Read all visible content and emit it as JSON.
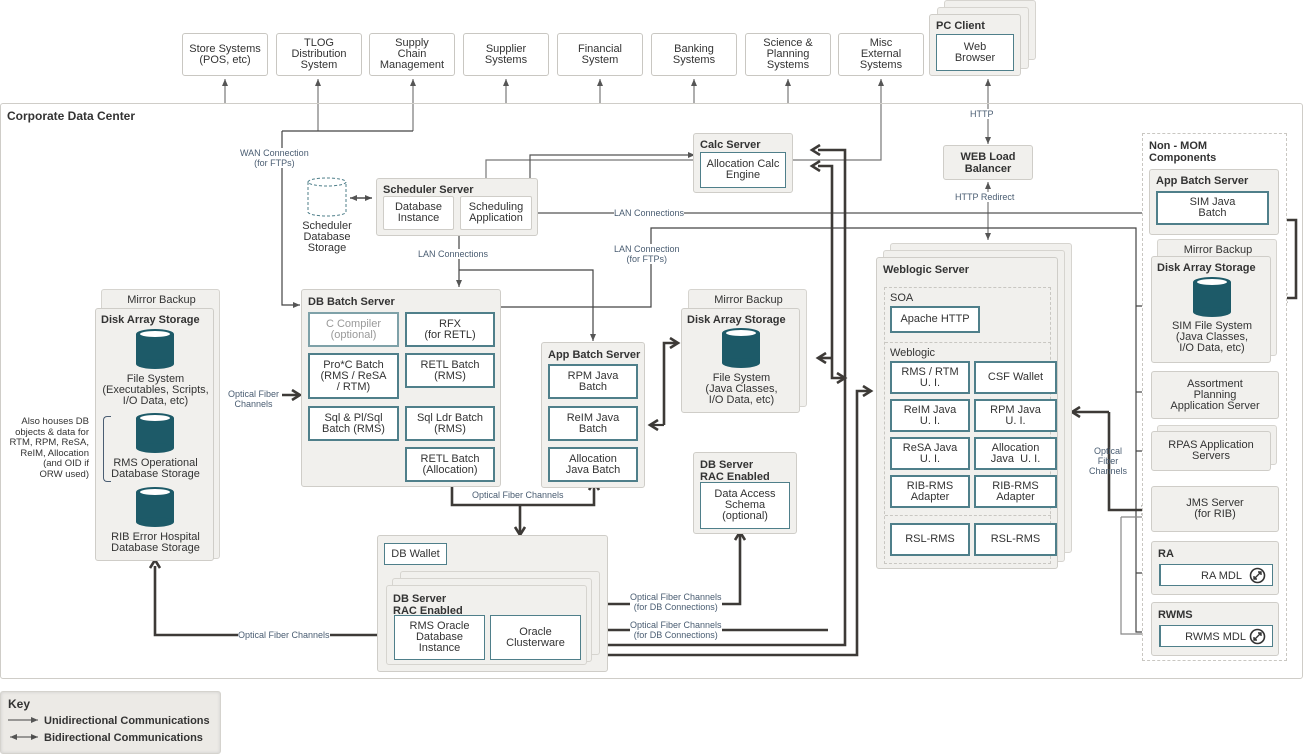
{
  "external_systems": [
    {
      "label": "Store Systems\n(POS, etc)"
    },
    {
      "label": "TLOG\nDistribution\nSystem"
    },
    {
      "label": "Supply\nChain\nManagement"
    },
    {
      "label": "Supplier\nSystems"
    },
    {
      "label": "Financial\nSystem"
    },
    {
      "label": "Banking\nSystems"
    },
    {
      "label": "Science &\nPlanning\nSystems"
    },
    {
      "label": "Misc\nExternal\nSystems"
    }
  ],
  "pc_client": {
    "title": "PC Client",
    "web_browser": "Web\nBrowser"
  },
  "data_center": {
    "title": "Corporate Data Center"
  },
  "connections": {
    "http": "HTTP",
    "http_redirect": "HTTP Redirect",
    "wan": "WAN Connection\n(for FTPs)",
    "lan_connections_1": "LAN Connections",
    "lan_connections_2": "LAN Connections",
    "lan_ftp": "LAN Connection\n(for FTPs)",
    "optical_left": "Optical Fiber\nChannels",
    "optical_batch": "Optical Fiber Channels",
    "optical_bottom": "Optical Fiber Channels",
    "optical_db_1": "Optical Fiber Channels\n(for DB Connections)",
    "optical_db_2": "Optical Fiber Channels\n(for DB Connections)",
    "optical_right": "Optical\nFiber\nChannels"
  },
  "web_load_balancer": {
    "title": "WEB Load\nBalancer"
  },
  "calc_server": {
    "title": "Calc Server",
    "engine": "Allocation Calc\nEngine"
  },
  "scheduler": {
    "storage_label": "Scheduler\nDatabase\nStorage",
    "title": "Scheduler Server",
    "db_instance": "Database\nInstance",
    "app": "Scheduling\nApplication"
  },
  "left_storage": {
    "mirror": "Mirror Backup",
    "title": "Disk Array Storage",
    "file_system": "File System\n(Executables, Scripts,\nI/O Data, etc)",
    "rms_db": "RMS Operational\nDatabase Storage",
    "rib_db": "RIB Error Hospital\nDatabase Storage",
    "note": "Also houses DB\nobjects & data for\nRTM, RPM, ReSA,\nReIM, Allocation\n(and OID if\nORW used)"
  },
  "db_batch_server": {
    "title": "DB Batch Server",
    "items": [
      {
        "label": "C Compiler\n(optional)"
      },
      {
        "label": "RFX\n(for RETL)"
      },
      {
        "label": "Pro*C Batch\n(RMS / ReSA\n/ RTM)"
      },
      {
        "label": "RETL Batch\n(RMS)"
      },
      {
        "label": "Sql & Pl/Sql\nBatch (RMS)"
      },
      {
        "label": "Sql Ldr Batch\n(RMS)"
      },
      {
        "label": "RETL Batch\n(Allocation)"
      }
    ]
  },
  "app_batch_server": {
    "title": "App Batch Server",
    "items": [
      {
        "label": "RPM Java\nBatch"
      },
      {
        "label": "ReIM Java\nBatch"
      },
      {
        "label": "Allocation\nJava Batch"
      }
    ]
  },
  "mid_storage": {
    "mirror": "Mirror Backup",
    "title": "Disk Array Storage",
    "file_system": "File System\n(Java Classes,\nI/O Data, etc)"
  },
  "db_server_das": {
    "title": "DB Server\nRAC Enabled",
    "schema": "Data Access\nSchema\n(optional)"
  },
  "db_server_main": {
    "wallet": "DB Wallet",
    "title": "DB Server\nRAC Enabled",
    "instance": "RMS Oracle\nDatabase\nInstance",
    "clusterware": "Oracle\nClusterware"
  },
  "weblogic_server": {
    "title": "Weblogic Server",
    "soa_label": "SOA",
    "apache": "Apache HTTP",
    "weblogic_label": "Weblogic",
    "items": [
      {
        "label": "RMS / RTM\nU. I."
      },
      {
        "label": "CSF Wallet"
      },
      {
        "label": "ReIM Java\nU. I."
      },
      {
        "label": "RPM Java\nU. I."
      },
      {
        "label": "ReSA Java\nU. I."
      },
      {
        "label": "Allocation\nJava  U. I."
      },
      {
        "label": "RIB-RMS\nAdapter"
      },
      {
        "label": "RIB-RMS\nAdapter"
      }
    ],
    "rsl": [
      {
        "label": "RSL-RMS"
      },
      {
        "label": "RSL-RMS"
      }
    ]
  },
  "non_mom": {
    "title": "Non - MOM\nComponents",
    "app_batch_title": "App Batch Server",
    "sim_batch": "SIM Java\nBatch",
    "mirror": "Mirror Backup",
    "storage_title": "Disk Array Storage",
    "sim_fs": "SIM File System\n(Java Classes,\nI/O Data, etc)",
    "assortment": "Assortment\nPlanning\nApplication Server",
    "rpas": "RPAS Application\nServers",
    "jms": "JMS Server\n(for RIB)",
    "ra_title": "RA",
    "ra_mdl": "RA MDL",
    "rwms_title": "RWMS",
    "rwms_mdl": "RWMS MDL"
  },
  "key": {
    "title": "Key",
    "uni": "Unidirectional Communications",
    "bi": "Bidirectional Communications"
  },
  "colors": {
    "storage": "#1d5a68",
    "box_border": "#4f7f8a",
    "panel": "#f1f0ed",
    "label": "#4a5d72"
  }
}
